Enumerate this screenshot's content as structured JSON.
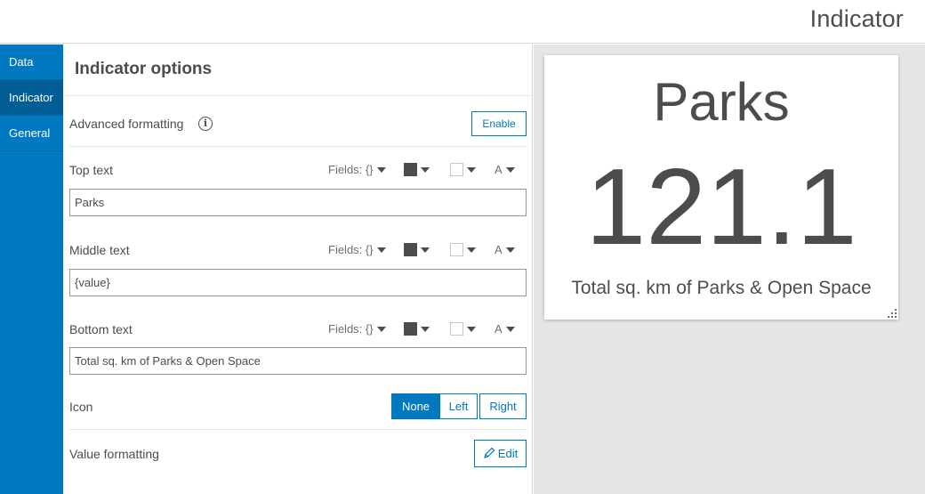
{
  "header": {
    "title": "Indicator"
  },
  "sidebar": {
    "items": [
      {
        "label": "Data",
        "active": false
      },
      {
        "label": "Indicator",
        "active": true
      },
      {
        "label": "General",
        "active": false
      }
    ]
  },
  "panel": {
    "title": "Indicator options",
    "advanced": {
      "label": "Advanced formatting",
      "info_icon": "i",
      "button": "Enable"
    },
    "top": {
      "label": "Top text",
      "value": "Parks"
    },
    "middle": {
      "label": "Middle text",
      "value": "{value}"
    },
    "bottom": {
      "label": "Bottom text",
      "value": "Total sq. km of Parks & Open Space"
    },
    "toolbar": {
      "fields": "Fields: {}",
      "font": "A"
    },
    "icon": {
      "label": "Icon",
      "options": [
        "None",
        "Left",
        "Right"
      ],
      "selected": "None"
    },
    "value_formatting": {
      "label": "Value formatting",
      "button": "Edit",
      "button_icon": "pencil-icon"
    }
  },
  "preview": {
    "top_text": "Parks",
    "middle_text": "121.1",
    "bottom_text": "Total sq. km of Parks & Open Space"
  },
  "colors": {
    "accent": "#0079c1",
    "text": "#4c4c4c",
    "preview_bg": "#e6e6e6"
  }
}
